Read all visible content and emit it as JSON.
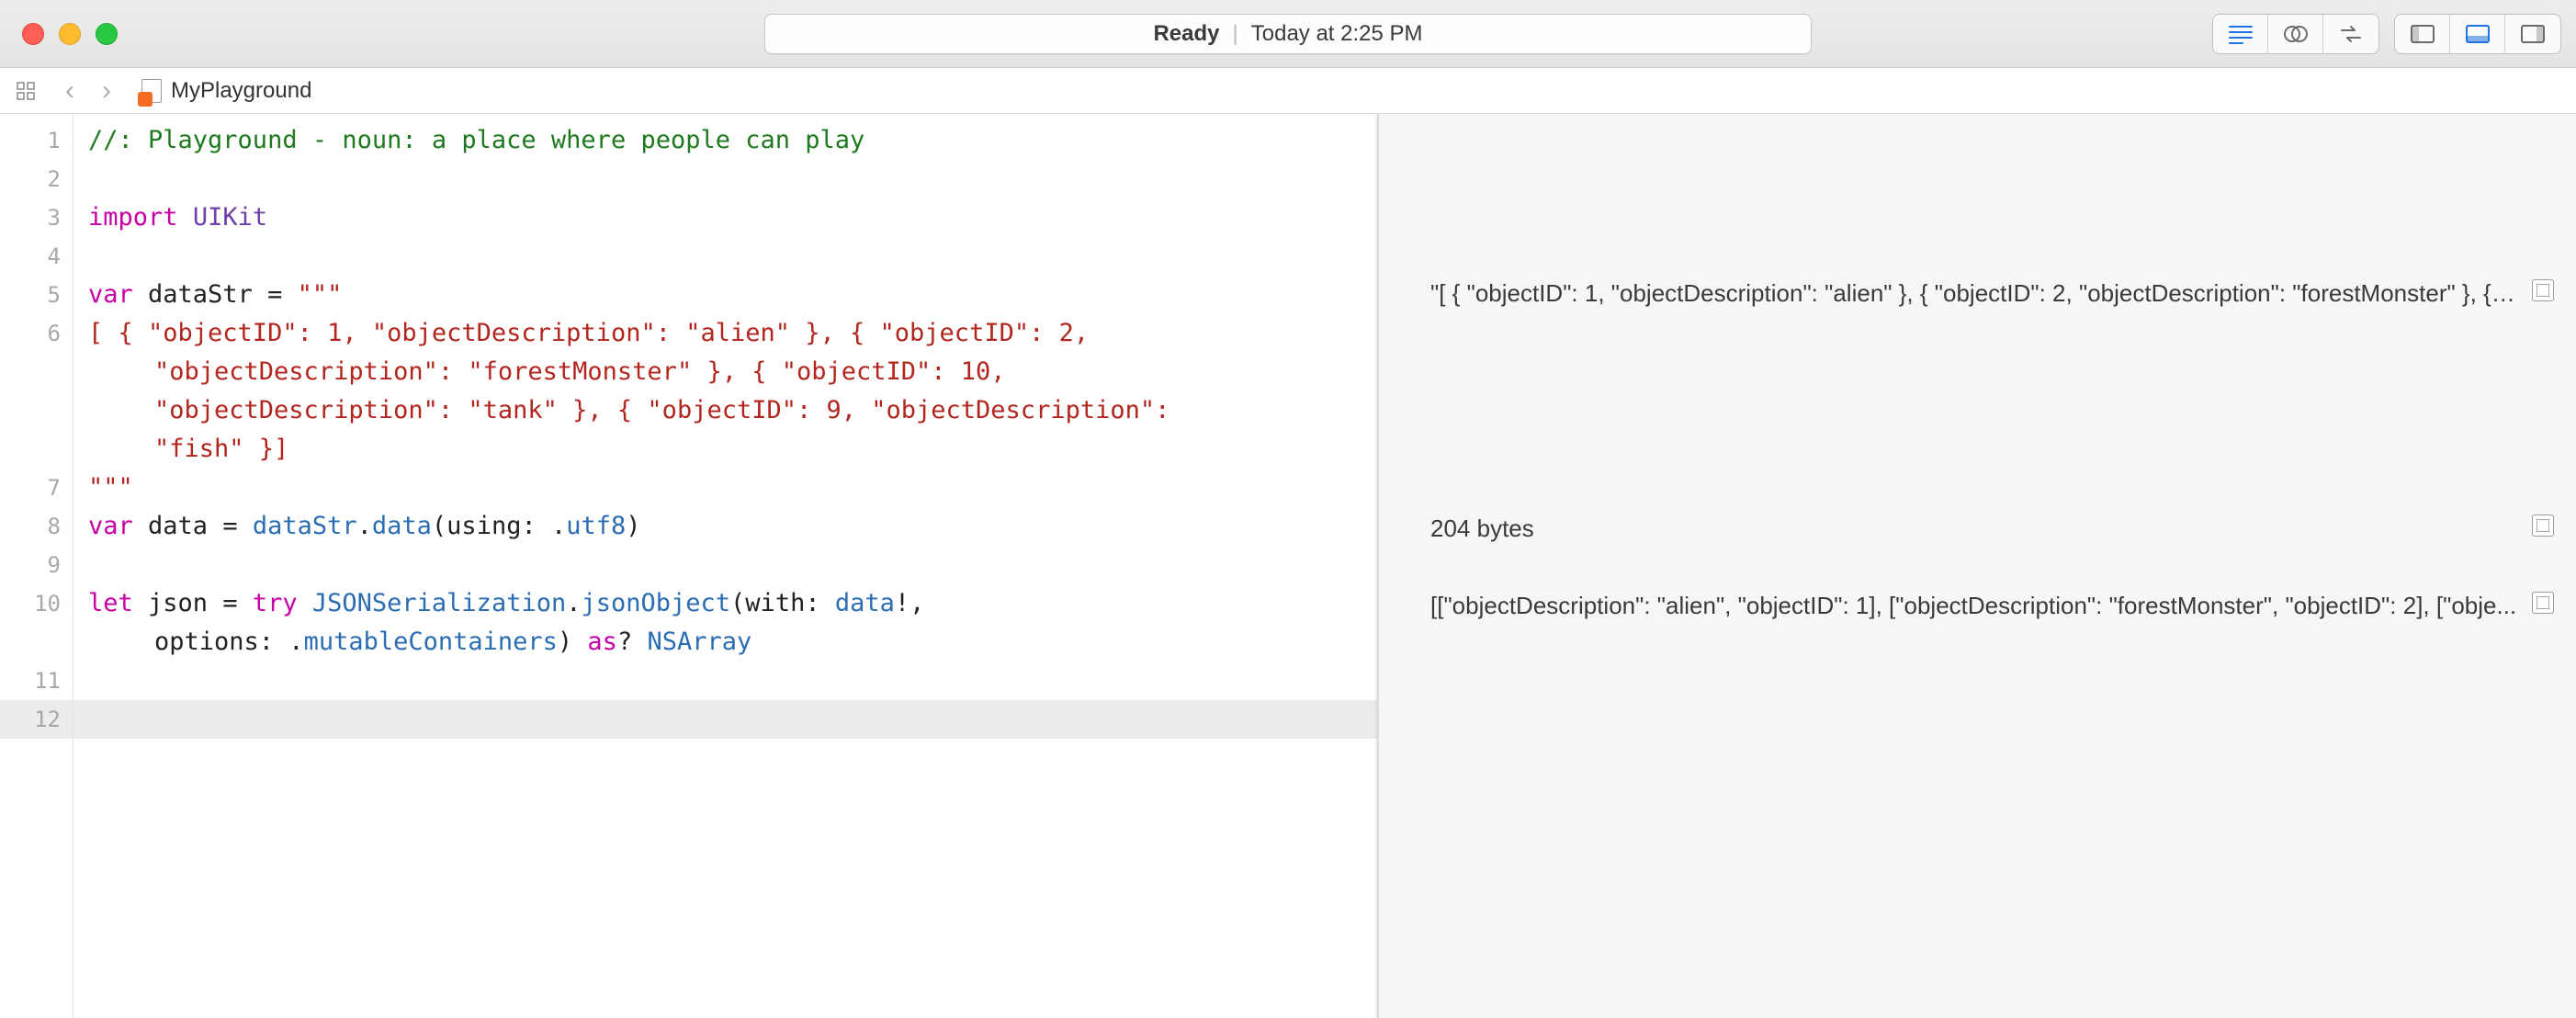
{
  "titlebar": {
    "status_ready": "Ready",
    "status_time": "Today at 2:25 PM"
  },
  "tabbar": {
    "filename": "MyPlayground"
  },
  "code_lines": [
    {
      "n": "1",
      "frags": [
        {
          "cls": "c-comment",
          "t": "//: Playground - noun: a place where people can play"
        }
      ]
    },
    {
      "n": "2",
      "frags": []
    },
    {
      "n": "3",
      "frags": [
        {
          "cls": "c-kw",
          "t": "import"
        },
        {
          "cls": "c-plain",
          "t": " "
        },
        {
          "cls": "c-kw2",
          "t": "UIKit"
        }
      ]
    },
    {
      "n": "4",
      "frags": []
    },
    {
      "n": "5",
      "frags": [
        {
          "cls": "c-kw",
          "t": "var"
        },
        {
          "cls": "c-plain",
          "t": " dataStr = "
        },
        {
          "cls": "c-str",
          "t": "\"\"\""
        }
      ]
    },
    {
      "n": "6",
      "frags": [
        {
          "cls": "c-str",
          "t": "[ { \"objectID\": 1, \"objectDescription\": \"alien\" }, { \"objectID\": 2,"
        }
      ]
    },
    {
      "n": "",
      "cont": true,
      "frags": [
        {
          "cls": "c-str",
          "t": "\"objectDescription\": \"forestMonster\" }, { \"objectID\": 10,"
        }
      ]
    },
    {
      "n": "",
      "cont": true,
      "frags": [
        {
          "cls": "c-str",
          "t": "\"objectDescription\": \"tank\" }, { \"objectID\": 9, \"objectDescription\":"
        }
      ]
    },
    {
      "n": "",
      "cont": true,
      "frags": [
        {
          "cls": "c-str",
          "t": "\"fish\" }]"
        }
      ]
    },
    {
      "n": "7",
      "frags": [
        {
          "cls": "c-str",
          "t": "\"\"\""
        }
      ]
    },
    {
      "n": "8",
      "frags": [
        {
          "cls": "c-kw",
          "t": "var"
        },
        {
          "cls": "c-plain",
          "t": " data = "
        },
        {
          "cls": "c-api",
          "t": "dataStr"
        },
        {
          "cls": "c-plain",
          "t": "."
        },
        {
          "cls": "c-api",
          "t": "data"
        },
        {
          "cls": "c-plain",
          "t": "(using: ."
        },
        {
          "cls": "c-api",
          "t": "utf8"
        },
        {
          "cls": "c-plain",
          "t": ")"
        }
      ]
    },
    {
      "n": "9",
      "frags": []
    },
    {
      "n": "10",
      "frags": [
        {
          "cls": "c-kw",
          "t": "let"
        },
        {
          "cls": "c-plain",
          "t": " json = "
        },
        {
          "cls": "c-kw",
          "t": "try"
        },
        {
          "cls": "c-plain",
          "t": " "
        },
        {
          "cls": "c-type",
          "t": "JSONSerialization"
        },
        {
          "cls": "c-plain",
          "t": "."
        },
        {
          "cls": "c-api",
          "t": "jsonObject"
        },
        {
          "cls": "c-plain",
          "t": "(with: "
        },
        {
          "cls": "c-api",
          "t": "data"
        },
        {
          "cls": "c-plain",
          "t": "!,"
        }
      ]
    },
    {
      "n": "",
      "cont": true,
      "frags": [
        {
          "cls": "c-plain",
          "t": "options: ."
        },
        {
          "cls": "c-api",
          "t": "mutableContainers"
        },
        {
          "cls": "c-plain",
          "t": ") "
        },
        {
          "cls": "c-kw",
          "t": "as"
        },
        {
          "cls": "c-plain",
          "t": "? "
        },
        {
          "cls": "c-type",
          "t": "NSArray"
        }
      ]
    },
    {
      "n": "11",
      "frags": []
    },
    {
      "n": "12",
      "current": true,
      "frags": []
    }
  ],
  "results": {
    "r1": "\"[ { \"objectID\": 1, \"objectDescription\": \"alien\" }, { \"objectID\": 2, \"objectDescription\": \"forestMonster\" }, { \"...",
    "r2": "204 bytes",
    "r3": "[[\"objectDescription\": \"alien\", \"objectID\": 1], [\"objectDescription\": \"forestMonster\", \"objectID\": 2], [\"obje..."
  }
}
